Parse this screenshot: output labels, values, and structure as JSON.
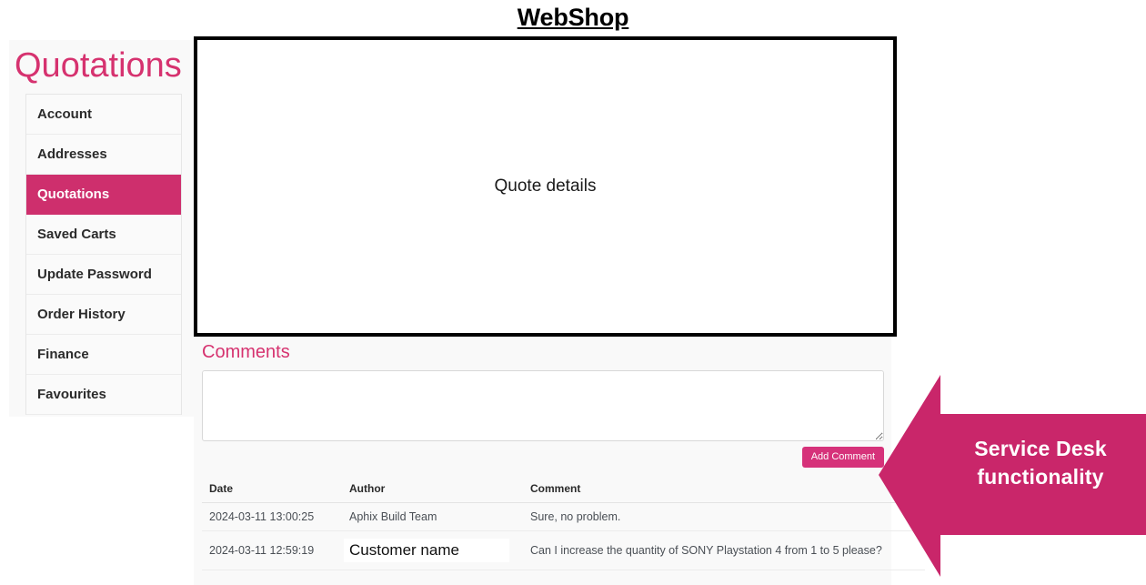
{
  "header": {
    "app_title": "WebShop"
  },
  "sidebar": {
    "page_title": "Quotations",
    "items": [
      {
        "label": "Account",
        "active": false
      },
      {
        "label": "Addresses",
        "active": false
      },
      {
        "label": "Quotations",
        "active": true
      },
      {
        "label": "Saved Carts",
        "active": false
      },
      {
        "label": "Update Password",
        "active": false
      },
      {
        "label": "Order History",
        "active": false
      },
      {
        "label": "Finance",
        "active": false
      },
      {
        "label": "Favourites",
        "active": false
      }
    ]
  },
  "quote_details": {
    "placeholder_label": "Quote details"
  },
  "comments": {
    "heading": "Comments",
    "textarea_value": "",
    "textarea_placeholder": "",
    "add_button_label": "Add Comment",
    "table": {
      "columns": [
        "Date",
        "Author",
        "Comment"
      ],
      "rows": [
        {
          "date": "2024-03-11 13:00:25",
          "author": "Aphix Build Team",
          "author_redacted": false,
          "comment": "Sure, no problem."
        },
        {
          "date": "2024-03-11 12:59:19",
          "author": "Customer name",
          "author_redacted": true,
          "comment": "Can I increase the quantity of SONY Playstation 4 from 1 to 5 please?"
        }
      ]
    }
  },
  "annotation": {
    "line1": "Service Desk",
    "line2": "functionality",
    "arrow_direction": "left",
    "arrow_color": "#c9266a"
  },
  "colors": {
    "brand_pink": "#d6326f",
    "active_nav": "#ce2f6d",
    "button_pink": "#d6327a",
    "annotation_pink": "#c9266a",
    "panel_bg": "#f9f9f9",
    "text_dark": "#2b2b2b"
  }
}
